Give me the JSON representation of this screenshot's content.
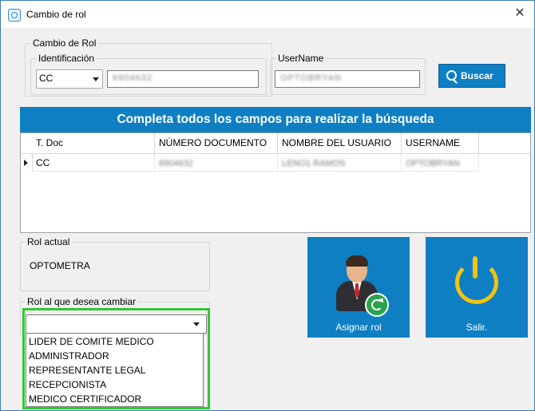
{
  "window": {
    "title": "Cambio de rol",
    "close_glyph": "✕"
  },
  "cambio_rol": {
    "legend": "Cambio de Rol",
    "identificacion_label": "Identificación",
    "doc_type_value": "CC",
    "doc_number_value": "6904632",
    "username_label": "UserName",
    "username_value": "OPTOBRYAN",
    "search_button": "Buscar"
  },
  "banner": "Completa todos los campos para realizar la búsqueda",
  "grid": {
    "columns": [
      "T. Doc",
      "NÚMERO DOCUMENTO",
      "NOMBRE DEL USUARIO",
      "USERNAME"
    ],
    "rows": [
      {
        "tdoc": "CC",
        "numero": "6904632",
        "nombre": "LENO1 RAMOS",
        "username": "OPTOBRYAN"
      }
    ]
  },
  "rol_actual": {
    "legend": "Rol actual",
    "value": "OPTOMETRA"
  },
  "rol_cambiar": {
    "legend": "Rol al que desea cambiar",
    "selected": "",
    "options": [
      "LIDER DE COMITE MEDICO",
      "ADMINISTRADOR",
      "REPRESENTANTE LEGAL",
      "RECEPCIONISTA",
      "MEDICO CERTIFICADOR"
    ]
  },
  "buttons": {
    "asignar": "Asignar rol",
    "salir": "Salir."
  },
  "colors": {
    "accent": "#0f7fc3",
    "power": "#f2c312",
    "refresh": "#29a34a",
    "highlight": "#31c831"
  }
}
